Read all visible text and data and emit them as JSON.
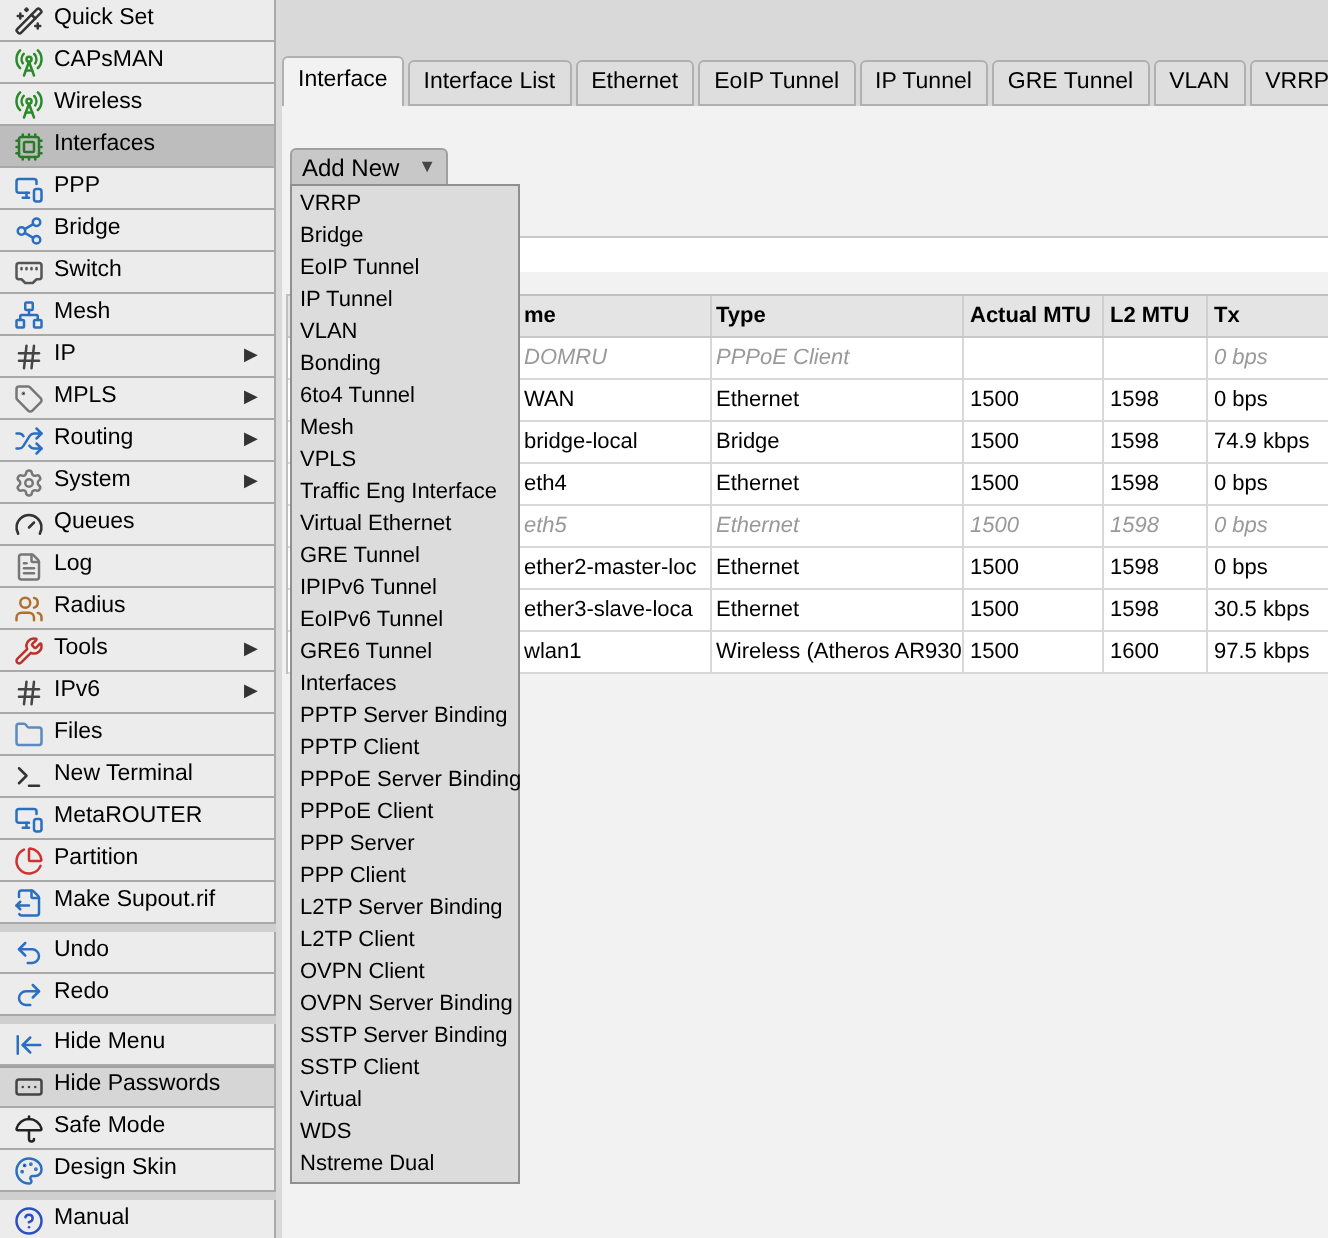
{
  "sidebar": {
    "groups": [
      [
        {
          "label": "Quick Set",
          "selected": false,
          "hovered": false
        },
        {
          "label": "CAPsMAN",
          "selected": false,
          "hovered": false
        },
        {
          "label": "Wireless",
          "selected": false,
          "hovered": false
        },
        {
          "label": "Interfaces",
          "selected": true,
          "hovered": false
        },
        {
          "label": "PPP",
          "selected": false,
          "hovered": false
        },
        {
          "label": "Bridge",
          "selected": false,
          "hovered": false
        },
        {
          "label": "Switch",
          "selected": false,
          "hovered": false
        },
        {
          "label": "Mesh",
          "selected": false,
          "hovered": false
        },
        {
          "label": "IP",
          "arrow": "▶",
          "selected": false,
          "hovered": false
        },
        {
          "label": "MPLS",
          "arrow": "▶",
          "selected": false,
          "hovered": false
        },
        {
          "label": "Routing",
          "arrow": "▶",
          "selected": false,
          "hovered": false
        },
        {
          "label": "System",
          "arrow": "▶",
          "selected": false,
          "hovered": false
        },
        {
          "label": "Queues",
          "selected": false,
          "hovered": false
        },
        {
          "label": "Log",
          "selected": false,
          "hovered": false
        },
        {
          "label": "Radius",
          "selected": false,
          "hovered": false
        },
        {
          "label": "Tools",
          "arrow": "▶",
          "selected": false,
          "hovered": false
        },
        {
          "label": "IPv6",
          "arrow": "▶",
          "selected": false,
          "hovered": false
        },
        {
          "label": "Files",
          "selected": false,
          "hovered": false
        },
        {
          "label": "New Terminal",
          "selected": false,
          "hovered": false
        },
        {
          "label": "MetaROUTER",
          "selected": false,
          "hovered": false
        },
        {
          "label": "Partition",
          "selected": false,
          "hovered": false
        },
        {
          "label": "Make Supout.rif",
          "selected": false,
          "hovered": false
        }
      ],
      [
        {
          "label": "Undo",
          "selected": false,
          "hovered": false
        },
        {
          "label": "Redo",
          "selected": false,
          "hovered": false
        }
      ],
      [
        {
          "label": "Hide Menu",
          "selected": false,
          "hovered": false
        },
        {
          "label": "Hide Passwords",
          "selected": false,
          "hovered": true
        },
        {
          "label": "Safe Mode",
          "selected": false,
          "hovered": false
        },
        {
          "label": "Design Skin",
          "selected": false,
          "hovered": false
        }
      ],
      [
        {
          "label": "Manual",
          "selected": false,
          "hovered": false
        }
      ]
    ]
  },
  "tabs": [
    {
      "label": "Interface",
      "selected": true
    },
    {
      "label": "Interface List",
      "selected": false
    },
    {
      "label": "Ethernet",
      "selected": false
    },
    {
      "label": "EoIP Tunnel",
      "selected": false
    },
    {
      "label": "IP Tunnel",
      "selected": false
    },
    {
      "label": "GRE Tunnel",
      "selected": false
    },
    {
      "label": "VLAN",
      "selected": false
    },
    {
      "label": "VRRP",
      "selected": false
    }
  ],
  "add_new": {
    "label": "Add New",
    "caret": "▼",
    "expanded": true,
    "options": [
      "VRRP",
      "Bridge",
      "EoIP Tunnel",
      "IP Tunnel",
      "VLAN",
      "Bonding",
      "6to4 Tunnel",
      "Mesh",
      "VPLS",
      "Traffic Eng Interface",
      "Virtual Ethernet",
      "GRE Tunnel",
      "IPIPv6 Tunnel",
      "EoIPv6 Tunnel",
      "GRE6 Tunnel",
      "Interfaces",
      "PPTP Server Binding",
      "PPTP Client",
      "PPPoE Server Binding",
      "PPPoE Client",
      "PPP Server",
      "PPP Client",
      "L2TP Server Binding",
      "L2TP Client",
      "OVPN Client",
      "OVPN Server Binding",
      "SSTP Server Binding",
      "SSTP Client",
      "Virtual",
      "WDS",
      "Nstreme Dual"
    ]
  },
  "table": {
    "columns": [
      "me",
      "Type",
      "Actual MTU",
      "L2 MTU",
      "Tx"
    ],
    "rows": [
      {
        "cells": [
          "DOMRU",
          "PPPoE Client",
          "",
          "",
          "0 bps"
        ],
        "disabled": true
      },
      {
        "cells": [
          "WAN",
          "Ethernet",
          "1500",
          "1598",
          "0 bps"
        ],
        "disabled": false
      },
      {
        "cells": [
          "bridge-local",
          "Bridge",
          "1500",
          "1598",
          "74.9 kbps"
        ],
        "disabled": false
      },
      {
        "cells": [
          "eth4",
          "Ethernet",
          "1500",
          "1598",
          "0 bps"
        ],
        "disabled": false
      },
      {
        "cells": [
          "eth5",
          "Ethernet",
          "1500",
          "1598",
          "0 bps"
        ],
        "disabled": true
      },
      {
        "cells": [
          "ether2-master-loc",
          "Ethernet",
          "1500",
          "1598",
          "0 bps"
        ],
        "disabled": false
      },
      {
        "cells": [
          "ether3-slave-loca",
          "Ethernet",
          "1500",
          "1598",
          "30.5 kbps"
        ],
        "disabled": false
      },
      {
        "cells": [
          "wlan1",
          "Wireless (Atheros AR930",
          "1500",
          "1600",
          "97.5 kbps"
        ],
        "disabled": false
      }
    ]
  }
}
